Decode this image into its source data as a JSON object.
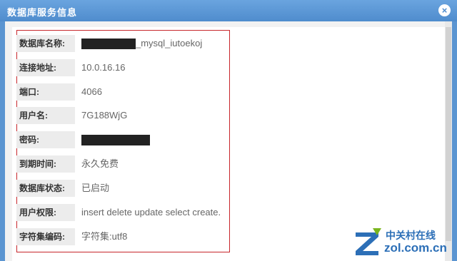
{
  "window": {
    "title": "数据库服务信息",
    "close_glyph": "×"
  },
  "fields": [
    {
      "label": "数据库名称:",
      "value": "_mysql_iutoekoj"
    },
    {
      "label": "连接地址:",
      "value": "10.0.16.16"
    },
    {
      "label": "端口:",
      "value": "4066"
    },
    {
      "label": "用户名:",
      "value": "7G188WjG"
    },
    {
      "label": "密码:",
      "value": ""
    },
    {
      "label": "到期时间:",
      "value": "永久免费"
    },
    {
      "label": "数据库状态:",
      "value": "已启动"
    },
    {
      "label": "用户权限:",
      "value": "insert delete update select create."
    },
    {
      "label": "字符集编码:",
      "value": "字符集:utf8"
    }
  ],
  "watermark": {
    "cn": "中关村在线",
    "url": "zol.com.cn",
    "logo": "Z"
  },
  "colors": {
    "header": "#4f8ccd",
    "frame": "#c7262b",
    "logo_blue": "#2c6fb7",
    "logo_green": "#7ab51d"
  }
}
